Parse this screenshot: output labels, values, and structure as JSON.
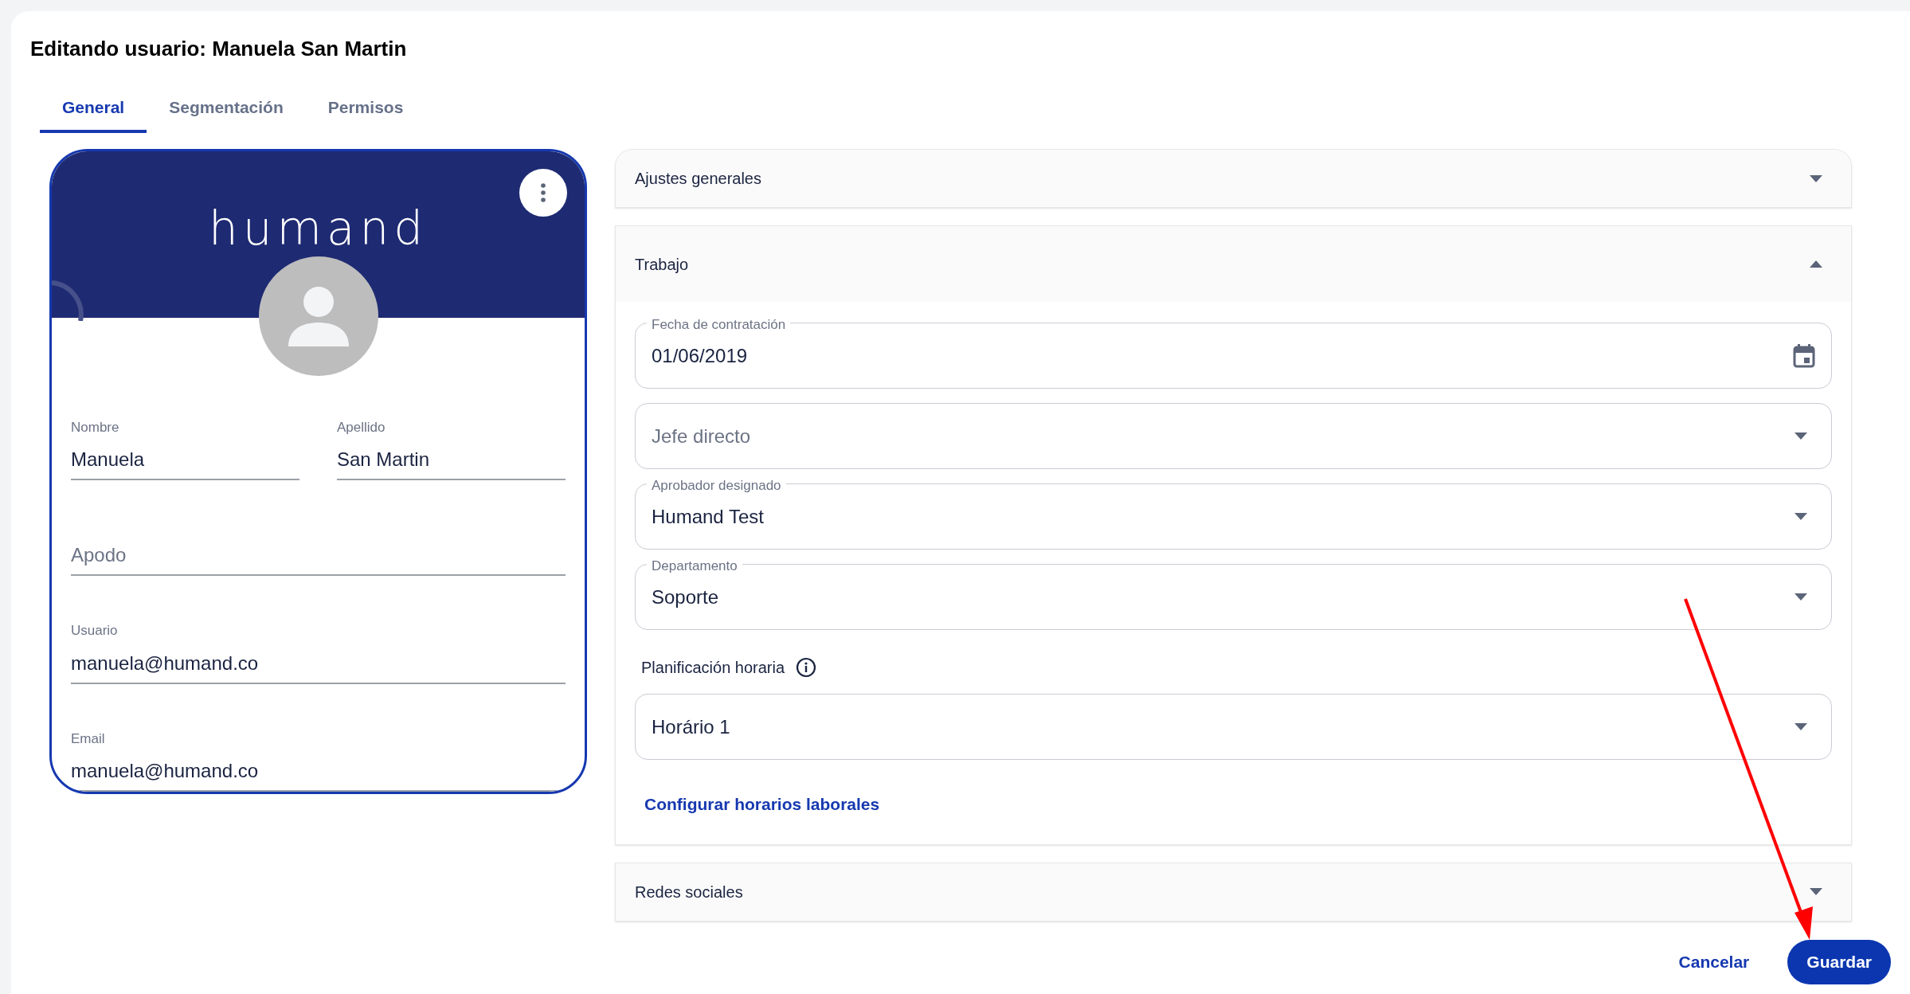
{
  "title": "Editando usuario: Manuela San Martin",
  "tabs": [
    {
      "label": "General",
      "selected": true
    },
    {
      "label": "Segmentación",
      "selected": false
    },
    {
      "label": "Permisos",
      "selected": false
    }
  ],
  "profile_card": {
    "logo": "humand",
    "name_fields": [
      {
        "label": "Nombre",
        "value": "Manuela"
      },
      {
        "label": "Apellido",
        "value": "San Martin"
      }
    ],
    "fields": [
      {
        "placeholder": "Apodo"
      },
      {
        "label": "Usuario",
        "value": "manuela@humand.co"
      },
      {
        "label": "Email",
        "value": "manuela@humand.co"
      }
    ]
  },
  "sections": [
    {
      "title": "Ajustes generales",
      "expanded": false
    },
    {
      "title": "Trabajo",
      "expanded": true,
      "items": [
        {
          "kind": "date",
          "label": "Fecha de contratación",
          "value": "01/06/2019"
        },
        {
          "kind": "select",
          "placeholder": "Jefe directo"
        },
        {
          "kind": "select",
          "label": "Aprobador designado",
          "value": "Humand Test"
        },
        {
          "kind": "select",
          "label": "Departamento",
          "value": "Soporte"
        },
        {
          "kind": "heading",
          "text": "Planificación horaria"
        },
        {
          "kind": "select",
          "value": "Horário 1"
        },
        {
          "kind": "link",
          "text": "Configurar horarios laborales"
        }
      ]
    },
    {
      "title": "Redes sociales",
      "expanded": false
    }
  ],
  "buttons": [
    {
      "kind": "text",
      "label": "Cancelar"
    },
    {
      "kind": "filled",
      "label": "Guardar"
    }
  ]
}
